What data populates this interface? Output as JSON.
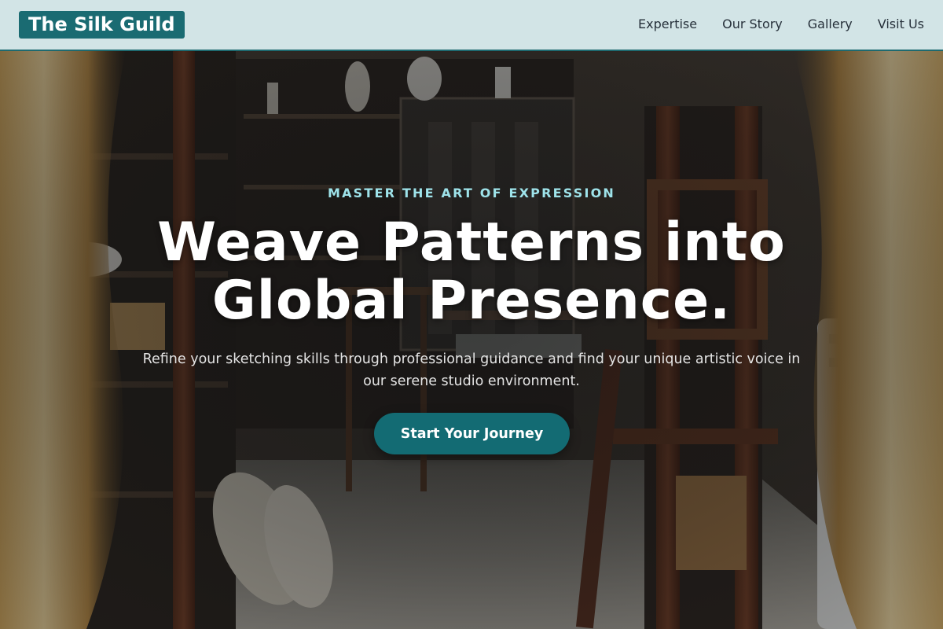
{
  "header": {
    "brand": "The Silk Guild",
    "nav": [
      "Expertise",
      "Our Story",
      "Gallery",
      "Visit Us"
    ]
  },
  "hero": {
    "eyebrow": "MASTER THE ART OF EXPRESSION",
    "headline_line1": "Weave Patterns into",
    "headline_line2": "Global Presence.",
    "subtext": "Refine your sketching skills through professional guidance and find your unique artistic voice in our serene studio environment.",
    "cta_label": "Start Your Journey",
    "background_image": "art-studio-with-easels-and-curtains"
  },
  "colors": {
    "header_bg": "#d2e4e6",
    "brand_bg": "#1a6b72",
    "accent": "#136b73",
    "eyebrow": "#9ee3ea"
  }
}
